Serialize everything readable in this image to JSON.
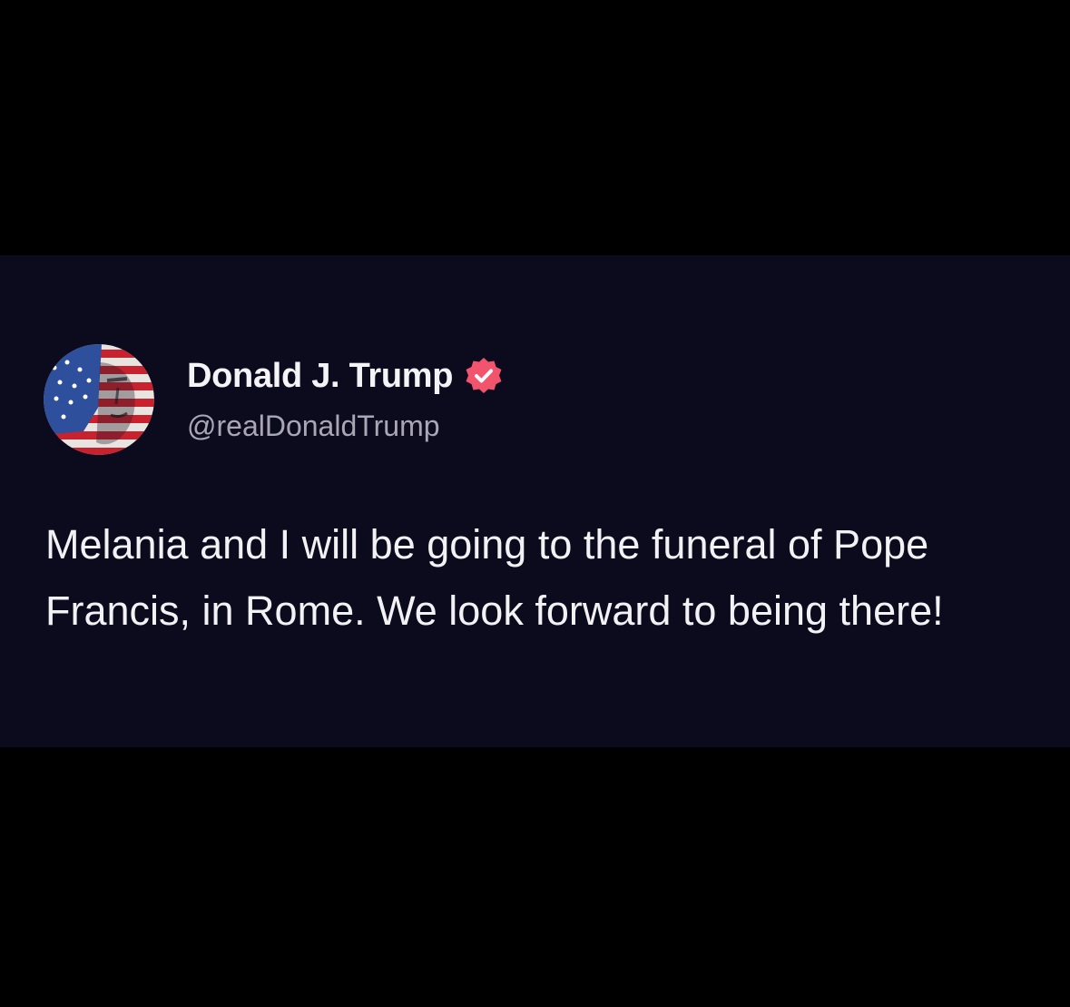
{
  "post": {
    "author": {
      "display_name": "Donald J. Trump",
      "handle": "@realDonaldTrump",
      "verified": true,
      "avatar_icon": "flag-portrait-avatar"
    },
    "text": "Melania and I will be going to the funeral of Pope Francis, in Rome. We look forward to being there!"
  },
  "colors": {
    "page_background": "#000000",
    "card_background": "#0c0a1d",
    "primary_text": "#f2f2f4",
    "secondary_text": "#a9a7b6",
    "verified_badge": "#f2546e"
  }
}
